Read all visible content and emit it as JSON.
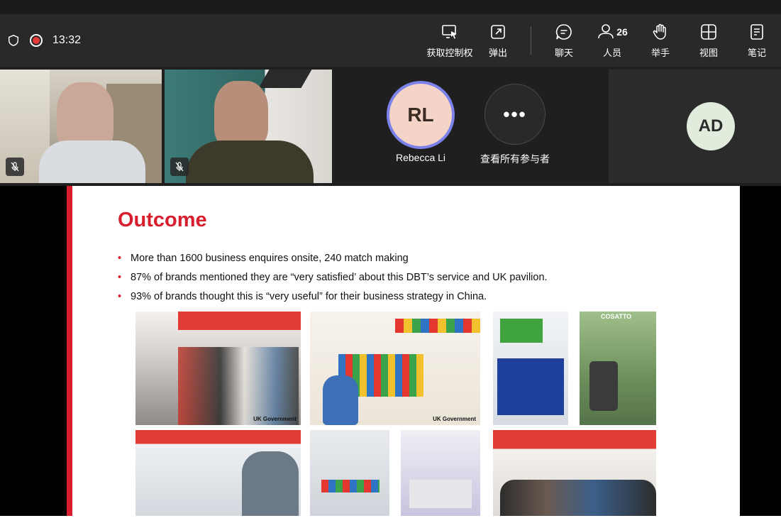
{
  "status": {
    "timer": "13:32"
  },
  "toolbar": {
    "items": [
      {
        "label": "获取控制权",
        "icon": "take-control-icon"
      },
      {
        "label": "弹出",
        "icon": "pop-out-icon"
      },
      {
        "label": "聊天",
        "icon": "chat-icon"
      },
      {
        "label": "人员",
        "icon": "people-icon",
        "count": "26"
      },
      {
        "label": "举手",
        "icon": "raise-hand-icon"
      },
      {
        "label": "视图",
        "icon": "view-icon"
      },
      {
        "label": "笔记",
        "icon": "notes-icon"
      }
    ]
  },
  "participants": {
    "rebecca": {
      "initials": "RL",
      "name": "Rebecca Li"
    },
    "more": {
      "glyph": "•••",
      "label": "查看所有参与者"
    },
    "ad": {
      "initials": "AD"
    }
  },
  "slide": {
    "title": "Outcome",
    "bullets": [
      "More than 1600 business enquires onsite, 240 match making",
      "87% of brands mentioned they are “very satisfied’ about this DBT’s service and UK pavilion.",
      "93% of brands thought this is “very useful” for their business strategy in China."
    ],
    "photo_labels": {
      "uk_gov": "UK Government",
      "cosatto": "COSATTO"
    }
  },
  "colors": {
    "accent": "#d81e2e",
    "avatar_ring": "#7b83eb",
    "record": "#e43a3a"
  }
}
